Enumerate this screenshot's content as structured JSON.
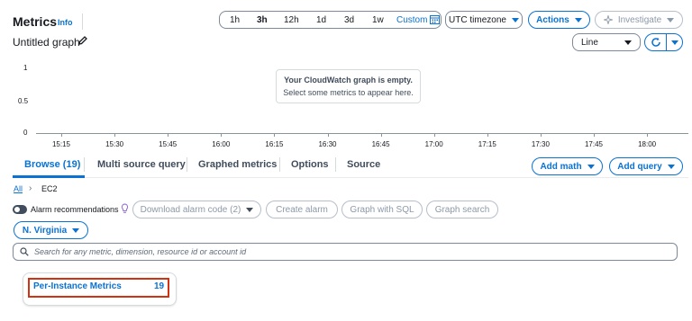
{
  "header": {
    "title": "Metrics",
    "info": "Info",
    "graph_name": "Untitled graph"
  },
  "time_range": {
    "options": [
      "1h",
      "3h",
      "12h",
      "1d",
      "3d",
      "1w"
    ],
    "selected": "3h",
    "custom": "Custom",
    "timezone": "UTC timezone"
  },
  "actions": {
    "actions": "Actions",
    "investigate": "Investigate",
    "chart_type": "Line"
  },
  "chart": {
    "empty_title": "Your CloudWatch graph is empty.",
    "empty_subtitle": "Select some metrics to appear here."
  },
  "chart_data": {
    "type": "line",
    "title": "",
    "xlabel": "",
    "ylabel": "",
    "y_ticks": [
      "1",
      "0.5",
      "0"
    ],
    "ylim": [
      0,
      1
    ],
    "x_ticks": [
      "15:15",
      "15:30",
      "15:45",
      "16:00",
      "16:15",
      "16:30",
      "16:45",
      "17:00",
      "17:15",
      "17:30",
      "17:45",
      "18:00"
    ],
    "series": []
  },
  "tabs": {
    "browse": "Browse (19)",
    "multi": "Multi source query",
    "graphed": "Graphed metrics",
    "options": "Options",
    "source": "Source",
    "add_math": "Add math",
    "add_query": "Add query"
  },
  "breadcrumb": {
    "all": "All",
    "current": "EC2"
  },
  "browse": {
    "alarm_recommendations": "Alarm recommendations",
    "download_alarm_code": "Download alarm code (2)",
    "create_alarm": "Create alarm",
    "graph_with_sql": "Graph with SQL",
    "graph_search": "Graph search",
    "region": "N. Virginia",
    "search_placeholder": "Search for any metric, dimension, resource id or account id",
    "card_label": "Per-Instance Metrics",
    "card_count": "19"
  }
}
